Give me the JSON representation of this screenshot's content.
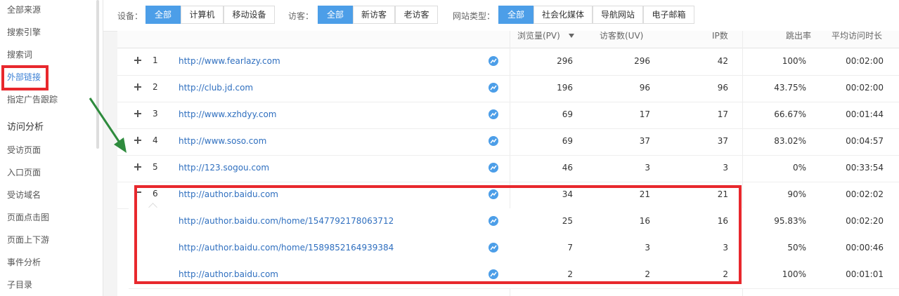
{
  "sidebar": {
    "items": [
      {
        "label": "全部来源"
      },
      {
        "label": "搜索引擎"
      },
      {
        "label": "搜索词"
      },
      {
        "label": "外部链接"
      },
      {
        "label": "指定广告跟踪"
      },
      {
        "label": "访问分析"
      },
      {
        "label": "受访页面"
      },
      {
        "label": "入口页面"
      },
      {
        "label": "受访域名"
      },
      {
        "label": "页面点击图"
      },
      {
        "label": "页面上下游"
      },
      {
        "label": "事件分析"
      },
      {
        "label": "子目录"
      }
    ]
  },
  "filters": {
    "device": {
      "label": "设备：",
      "options": [
        "全部",
        "计算机",
        "移动设备"
      ],
      "selected": "全部"
    },
    "visitor": {
      "label": "访客：",
      "options": [
        "全部",
        "新访客",
        "老访客"
      ],
      "selected": "全部"
    },
    "site_type": {
      "label": "网站类型：",
      "options": [
        "全部",
        "社会化媒体",
        "导航网站",
        "电子邮箱"
      ],
      "selected": "全部"
    }
  },
  "table": {
    "headers": {
      "pv": "浏览量(PV)",
      "uv": "访客数(UV)",
      "ip": "IP数",
      "bounce": "跳出率",
      "avg_time": "平均访问时长"
    },
    "rows": [
      {
        "idx": "1",
        "url": "http://www.fearlazy.com",
        "pv": "296",
        "uv": "296",
        "ip": "42",
        "bounce": "100%",
        "avg": "00:02:00"
      },
      {
        "idx": "2",
        "url": "http://club.jd.com",
        "pv": "196",
        "uv": "96",
        "ip": "96",
        "bounce": "43.75%",
        "avg": "00:02:00"
      },
      {
        "idx": "3",
        "url": "http://www.xzhdyy.com",
        "pv": "69",
        "uv": "17",
        "ip": "17",
        "bounce": "66.67%",
        "avg": "00:01:44"
      },
      {
        "idx": "4",
        "url": "http://www.soso.com",
        "pv": "69",
        "uv": "37",
        "ip": "37",
        "bounce": "83.02%",
        "avg": "00:04:57"
      },
      {
        "idx": "5",
        "url": "http://123.sogou.com",
        "pv": "46",
        "uv": "3",
        "ip": "3",
        "bounce": "0%",
        "avg": "00:33:54"
      },
      {
        "idx": "6",
        "url": "http://author.baidu.com",
        "pv": "34",
        "uv": "21",
        "ip": "21",
        "bounce": "90%",
        "avg": "00:02:02"
      }
    ],
    "subrows": [
      {
        "url": "http://author.baidu.com/home/1547792178063712",
        "pv": "25",
        "uv": "16",
        "ip": "16",
        "bounce": "95.83%",
        "avg": "00:02:20"
      },
      {
        "url": "http://author.baidu.com/home/1589852164939384",
        "pv": "7",
        "uv": "3",
        "ip": "3",
        "bounce": "50%",
        "avg": "00:00:46"
      },
      {
        "url": "http://author.baidu.com",
        "pv": "2",
        "uv": "2",
        "ip": "2",
        "bounce": "100%",
        "avg": "00:01:01"
      }
    ]
  }
}
